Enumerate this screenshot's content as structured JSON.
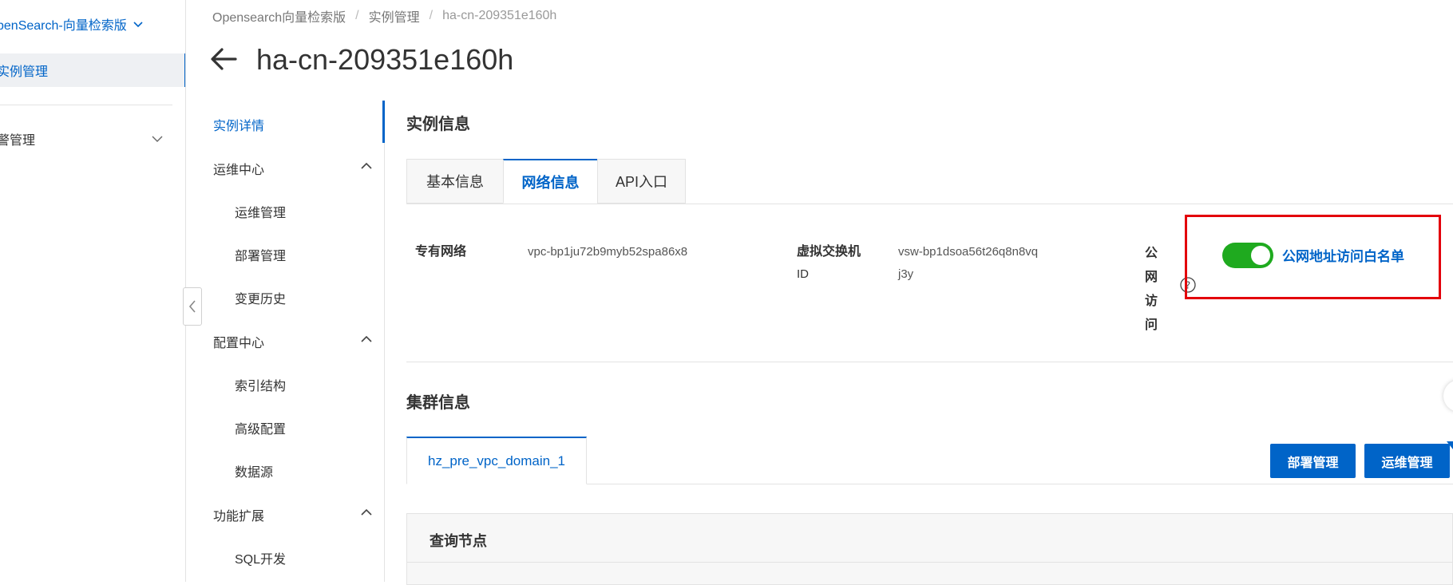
{
  "sidebar": {
    "product": "penSearch-向量检索版",
    "active_item": "实例管理",
    "group_item": "警管理"
  },
  "breadcrumb": {
    "items": [
      "Opensearch向量检索版",
      "实例管理",
      "ha-cn-209351e160h"
    ]
  },
  "page": {
    "title": "ha-cn-209351e160h"
  },
  "secnav": {
    "detail": "实例详情",
    "ops_center": "运维中心",
    "ops_manage": "运维管理",
    "deploy_manage": "部署管理",
    "change_history": "变更历史",
    "config_center": "配置中心",
    "index_structure": "索引结构",
    "advanced_config": "高级配置",
    "data_source": "数据源",
    "extensions": "功能扩展",
    "sql_dev": "SQL开发"
  },
  "instance_info": {
    "title": "实例信息",
    "tabs": [
      "基本信息",
      "网络信息",
      "API入口"
    ],
    "active_tab": "网络信息",
    "vpc_label": "专有网络",
    "vpc_value": "vpc-bp1ju72b9myb52spa86x8",
    "vswitch_label_1": "虚拟交换机",
    "vswitch_label_2": "ID",
    "vswitch_value_1": "vsw-bp1dsoa56t26q8n8vq",
    "vswitch_value_2": "j3y",
    "public_access_chars": [
      "公",
      "网",
      "访",
      "问"
    ],
    "public_access_enabled": true,
    "whitelist_link": "公网地址访问白名单"
  },
  "cluster_info": {
    "title": "集群信息",
    "tab": "hz_pre_vpc_domain_1",
    "deploy_button": "部署管理",
    "ops_button": "运维管理",
    "query_node_title": "查询节点"
  },
  "colors": {
    "accent": "#0064c8",
    "toggle_on": "#1faa1f",
    "highlight_box": "#e3000b"
  }
}
